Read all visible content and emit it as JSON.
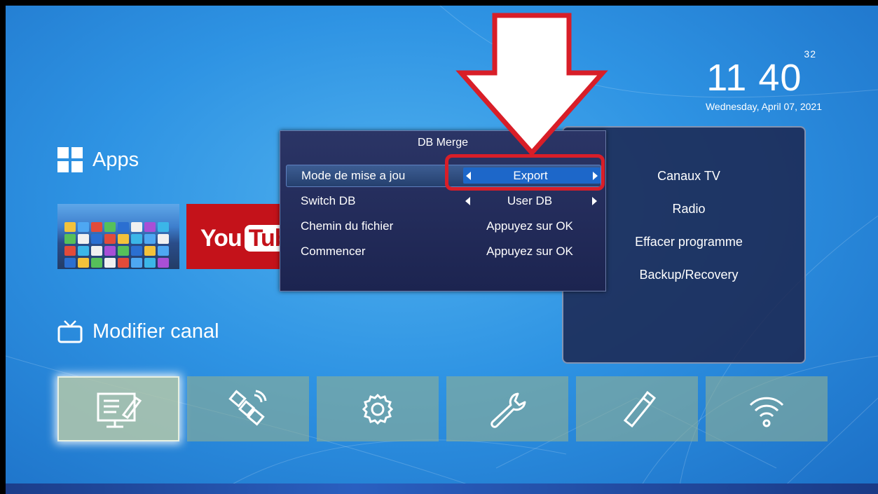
{
  "clock": {
    "hour": "11",
    "minute": "40",
    "second": "32",
    "date": "Wednesday, April 07, 2021"
  },
  "sections": {
    "apps": "Apps",
    "canal": "Modifier canal"
  },
  "tiles": {
    "apps_icon": "apps-grid-icon",
    "youtube": {
      "you": "You",
      "tube": "Tub"
    }
  },
  "dialog": {
    "title": "DB Merge",
    "rows": [
      {
        "label": "Mode de mise a jou",
        "value": "Export",
        "selected": true
      },
      {
        "label": "Switch DB",
        "value": "User DB",
        "selected": false
      },
      {
        "label": "Chemin du fichier",
        "value": "Appuyez sur OK",
        "selected": false
      },
      {
        "label": "Commencer",
        "value": "Appuyez sur OK",
        "selected": false
      }
    ]
  },
  "right_menu": [
    "Canaux TV",
    "Radio",
    "Effacer programme",
    "Backup/Recovery"
  ],
  "bottom_tiles": [
    {
      "icon": "edit-list-icon",
      "active": true
    },
    {
      "icon": "satellite-icon",
      "active": false
    },
    {
      "icon": "gear-icon",
      "active": false
    },
    {
      "icon": "wrench-icon",
      "active": false
    },
    {
      "icon": "usb-icon",
      "active": false
    },
    {
      "icon": "wifi-icon",
      "active": false
    }
  ],
  "colors": {
    "background": "#2e93e3",
    "callout": "#d81e28",
    "selected_value": "#1d67c9",
    "youtube": "#c4121a"
  }
}
